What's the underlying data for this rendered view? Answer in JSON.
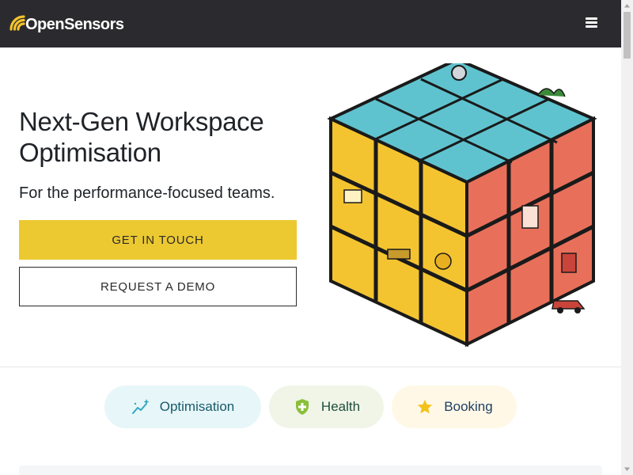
{
  "header": {
    "brand": "OpenSensors",
    "menu_icon": "hamburger-menu-icon",
    "background": "#2b2b2f",
    "logo_color": "#f5c32c"
  },
  "hero": {
    "title_line1": "Next-Gen Workspace",
    "title_line2": "Optimisation",
    "subtitle": "For the performance-focused teams.",
    "primary_button": "GET IN TOUCH",
    "secondary_button": "REQUEST A DEMO",
    "primary_color": "#ecc931",
    "illustration": "isometric-office-cube-illustration"
  },
  "tabs": [
    {
      "label": "Optimisation",
      "icon": "trend-sparkle-icon",
      "background": "#e7f6f8",
      "color": "#185a6b"
    },
    {
      "label": "Health",
      "icon": "shield-plus-icon",
      "background": "#f0f5e8",
      "color": "#1e4d3c"
    },
    {
      "label": "Booking",
      "icon": "star-icon",
      "background": "#fff8e6",
      "color": "#1f3f66"
    }
  ]
}
